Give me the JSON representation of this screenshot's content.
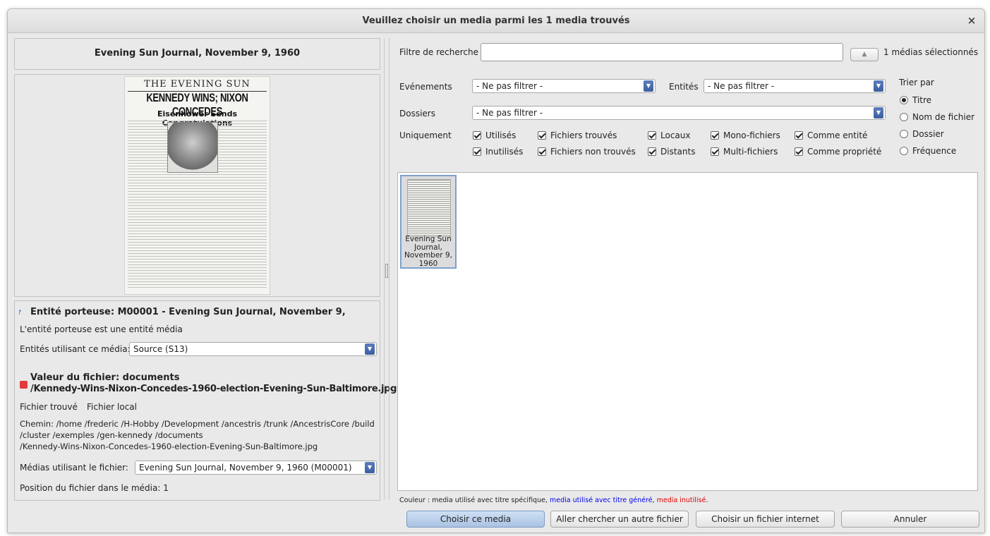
{
  "window": {
    "title": "Veuillez choisir un media parmi les 1 media trouvés",
    "close": "×"
  },
  "left": {
    "media_title": "Evening Sun Journal, November 9, 1960",
    "thumbnail": {
      "masthead": "THE EVENING SUN",
      "headline": "KENNEDY WINS; NIXON CONCEDES",
      "subhead": "Eisenhower Sends Congratulations"
    },
    "entity_heading": "Entité porteuse: M00001 - Evening Sun Journal, November 9,",
    "entity_desc": "L'entité porteuse est une entité média",
    "entities_using_label": "Entités utilisant ce média:",
    "entities_using_value": "Source (S13)",
    "file_value_line1": "Valeur du fichier: documents",
    "file_value_line2": "/Kennedy-Wins-Nixon-Concedes-1960-election-Evening-Sun-Baltimore.jpg",
    "file_found": "Fichier trouvé",
    "file_local": "Fichier local",
    "path_line1": "Chemin: /home /frederic /H-Hobby /Development /ancestris /trunk /AncestrisCore /build",
    "path_line2": "/cluster /exemples /gen-kennedy /documents",
    "path_line3": "/Kennedy-Wins-Nixon-Concedes-1960-election-Evening-Sun-Baltimore.jpg",
    "medias_using_label": "Médias utilisant le fichier:",
    "medias_using_value": "Evening Sun Journal, November 9, 1960 (M00001)",
    "position": "Position du fichier dans le média: 1"
  },
  "filters": {
    "search_label": "Filtre de recherche",
    "search_value": "",
    "selected_count": "1 médias sélectionnés",
    "events_label": "Evénements",
    "events_value": "- Ne pas filtrer -",
    "entities_label": "Entités",
    "entities_value": "- Ne pas filtrer -",
    "folders_label": "Dossiers",
    "folders_value": "- Ne pas filtrer -",
    "only_label": "Uniquement",
    "checks": {
      "used": "Utilisés",
      "unused": "Inutilisés",
      "found": "Fichiers trouvés",
      "not_found": "Fichiers non trouvés",
      "local": "Locaux",
      "remote": "Distants",
      "mono": "Mono-fichiers",
      "multi": "Multi-fichiers",
      "as_entity": "Comme entité",
      "as_property": "Comme propriété"
    },
    "sort_label": "Trier par",
    "sort_options": [
      "Titre",
      "Nom de fichier",
      "Dossier",
      "Fréquence"
    ],
    "sort_selected": "Titre"
  },
  "grid": {
    "items": [
      {
        "caption_l1": "Evening Sun",
        "caption_l2": "Journal,",
        "caption_l3": "November 9,",
        "caption_l4": "1960"
      }
    ]
  },
  "legend": {
    "prefix": "Couleur : media utilisé avec titre spécifique, ",
    "blue": "media utilisé avec titre généré",
    "sep": ", ",
    "red": "media inutilisé",
    "suffix": ".",
    "blue_color": "#0000ee",
    "red_color": "#e00000"
  },
  "buttons": {
    "choose": "Choisir ce media",
    "browse": "Aller chercher un autre fichier",
    "internet": "Choisir un fichier internet",
    "cancel": "Annuler"
  }
}
